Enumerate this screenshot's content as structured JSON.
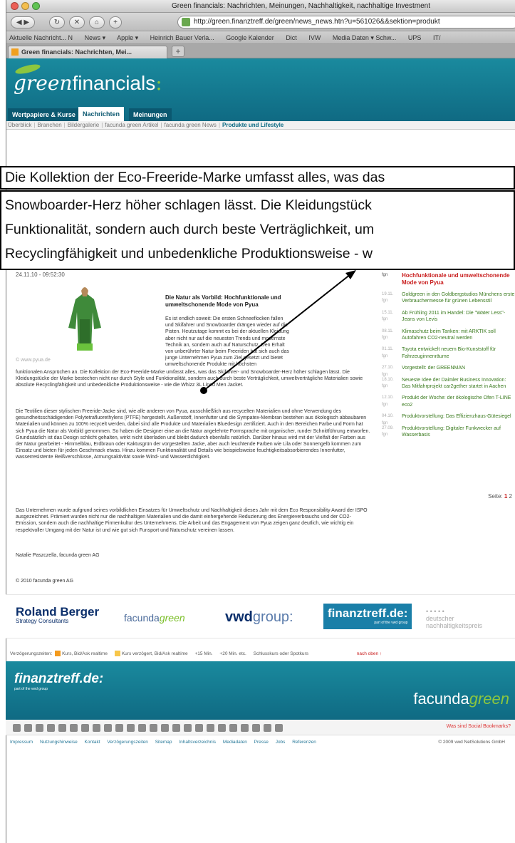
{
  "browser": {
    "window_title": "Green financials: Nachrichten, Meinungen, Nachhaltigkeit, nachhaltige Investment",
    "url": "http://green.finanztreff.de/green/news_news.htn?u=561026&&sektion=produkt",
    "bookmarks": [
      "Aktuelle Nachricht... ⁠N",
      "News ▾",
      "Apple ▾",
      "Heinrich Bauer Verla...",
      "Google Kalender",
      "Dict",
      "IVW",
      "Media Daten ▾ Schw...",
      "UPS",
      "IT/"
    ],
    "tab_title": "Green financials: Nachrichten, Mei...",
    "tab_add": "+"
  },
  "site": {
    "logo_prefix": "green",
    "logo_word": "financials",
    "logo_colon": ":",
    "nav_tabs": [
      "Wertpapiere & Kurse",
      "Nachrichten",
      "Meinungen"
    ],
    "subnav": [
      "Überblick",
      "Branchen",
      "Bildergalerie",
      "facunda green Artikel",
      "facunda green News",
      "Produkte und Lifestyle"
    ]
  },
  "zoom": {
    "line1": "Die Kollektion der Eco-Freeride-Marke umfasst alles, was das",
    "line2": "Snowboarder-Herz höher schlagen lässt. Die Kleidungstück",
    "line3": "Funktionalität, sondern auch durch beste Verträglichkeit, um",
    "line4": "Recyclingfähigkeit und unbedenkliche Produktionsweise - w"
  },
  "article": {
    "date": "24.11.10 - 09:52:30",
    "photo_credit": "© www.pyua.de",
    "headline": "Die Natur als Vorbild: Hochfunktionale und umweltschonende Mode von Pyua",
    "intro": "Es ist endlich soweit: Die ersten Schneeflocken fallen und Skifahrer und Snowboarder drängen wieder auf die Pisten. Heutzutage kommt es bei der aktuellen Kleidung aber nicht nur auf die neuesten Trends und modernste Technik an, sondern auch auf Naturschutz. Den Erhalt von unberührter Natur beim Freeriden hat sich auch das junge Unternehmen Pyua zum Ziel gesetzt und bietet umweltschonende Produkte mit höchsten",
    "p1": "funktionalen Ansprüchen an. Die Kollektion der Eco-Freeride-Marke umfasst alles, was das Skifahrer- und Snowboarder-Herz höher schlagen lässt. Die Kleidungstücke der Marke bestechen nicht nur durch Style und Funktionalität, sondern auch durch beste Verträglichkeit, umweltverträgliche Materialien sowie absolute Recyclingfähigkeit und unbedenkliche Produktionsweise - wie die Whizz 3L Lined Men Jacket.",
    "p2": "Die Textilien dieser stylischen Freeride-Jacke sind, wie alle anderen von Pyua, ausschließlich aus recycelten Materialien und ohne Verwendung des gesundheitsschädigenden Polytetrafluorethylens (PTFE) hergestellt. Außenstoff, Innenfutter und die Sympatex-Membran bestehen aus ökologisch abbaubaren Materialien und können zu 100% recycelt werden, dabei sind alle Produkte und Materialien Bluedesign zertifiziert. Auch in den Bereichen Farbe und Form hat sich Pyua die Natur als Vorbild genommen. So haben die Designer eine an die Natur angelehnte Formsprache mit organischer, runder Schnittführung entworfen. Grundsätzlich ist das Design schlicht gehalten, wirkt nicht überladen und bleibt dadurch ebenfalls natürlich. Darüber hinaus wird mit der Vielfalt der Farben aus der Natur gearbeitet - Himmelblau, Erdbraun oder Kaktusgrün der vorgestellten Jacke, aber auch leuchtende Farben wie Lila oder Sonnengelb kommen zum Einsatz und bieten für jeden Geschmack etwas. Hinzu kommen Funktionalität und Details wie beispielsweise feuchtigkeitsabsorbierendes Innenfutter, wasserresistente Reißverschlüsse, Atmungsaktivität sowie Wind- und Wasserdichtigkeit.",
    "p3": "Das Unternehmen wurde aufgrund seines vorbildlichen Einsatzes für Umweltschutz und Nachhaltigkeit dieses Jahr mit dem Eco Responsibility Award der ISPO ausgezeichnet. Prämiert wurden nicht nur die nachhaltigen Materialien und die damit einhergehende Reduzierung des Energieverbrauchs und der CO2-Emission, sondern auch die nachhaltige Firmenkultur des Unternehmens. Die Arbeit und das Engagement von Pyua zeigen ganz deutlich, wie wichtig ein respektvoller Umgang mit der Natur ist und wie gut sich Funsport und Naturschutz vereinen lassen.",
    "author": "Natalie Paszczella, facunda green AG",
    "copyright": "© 2010 facunda green AG"
  },
  "sidebar": {
    "items": [
      {
        "meta": "fgn",
        "title": "Hochfunktionale und umweltschonende Mode von Pyua"
      },
      {
        "meta": "19.11. fgn",
        "title": "Goldgreen in den Goldbergstudios Münchens erste Verbrauchermesse für grünen Lebensstil"
      },
      {
        "meta": "15.11. fgn",
        "title": "Ab Frühling 2011 im Handel: Die \"Water Less\"-Jeans von Levis"
      },
      {
        "meta": "08.11. fgn",
        "title": "Klimaschutz beim Tanken: mit ARKTIK soll Autofahren CO2-neutral werden"
      },
      {
        "meta": "01.11. fgn",
        "title": "Toyota entwickelt neuem Bio-Kunststoff für Fahrzeuginnenräume"
      },
      {
        "meta": "27.10. fgn",
        "title": "Vorgestellt: der GREENMAN"
      },
      {
        "meta": "18.10. fgn",
        "title": "Neueste Idee der Daimler Business Innovation: Das Mitfahrprojekt car2gether startet in Aachen"
      },
      {
        "meta": "12.10. fgn",
        "title": "Produkt der Woche: der ökologische Ofen T-LINE eco2"
      },
      {
        "meta": "04.10. fgn",
        "title": "Produktvorstellung: Das Effizienzhaus-Gütesiegel"
      },
      {
        "meta": "27.09. fgn",
        "title": "Produktvorstellung: Digitaler Funkwecker auf Wasserbasis"
      }
    ],
    "pager_label": "Seite:",
    "pager_current": "1",
    "pager_next": "2"
  },
  "partners": {
    "roland_berger": "Roland Berger",
    "roland_berger_sub": "Strategy Consultants",
    "facunda": "facunda",
    "facunda_green": "green",
    "vwd": "vwd",
    "vwd_group": "group:",
    "finanztreff": "finanztreff.de:",
    "finanztreff_sub": "part of the vwd group",
    "dnp_line1": "deutscher",
    "dnp_line2": "nachhaltigkeitspreis",
    "dnp_dots": "• • • • •"
  },
  "delays": {
    "label": "Verzögerungszeiten:",
    "realtime": "Kurs, Bid/Ask realtime",
    "delayed": "Kurs verzögert, Bid/Ask realtime",
    "m15": "+15 Min.",
    "m20": "+20 Min. etc.",
    "closing": "Schlusskurs oder Spotkurs",
    "top": "nach oben ↑",
    "colors": {
      "realtime": "#f39a1e",
      "delayed": "#f7c64a"
    }
  },
  "footer": {
    "finanztreff": "finanztreff.de:",
    "finanztreff_sub": "part of the vwd group",
    "facunda": "facunda",
    "facunda_green": "green",
    "social_link": "Was sind Social Bookmarks?",
    "links": [
      "Impressum",
      "Nutzungshinweise",
      "Kontakt",
      "Verzögerungszeiten",
      "Sitemap",
      "Inhaltsverzeichnis",
      "Mediadaten",
      "Presse",
      "Jobs",
      "Referenzen"
    ],
    "copyright": "© 2009 vwd NetSolutions GmbH"
  },
  "colors": {
    "brand_teal": "#0f6a83",
    "brand_green": "#8cc63f",
    "headline_red": "#c81c1c",
    "link_green": "#3a7a1e"
  }
}
